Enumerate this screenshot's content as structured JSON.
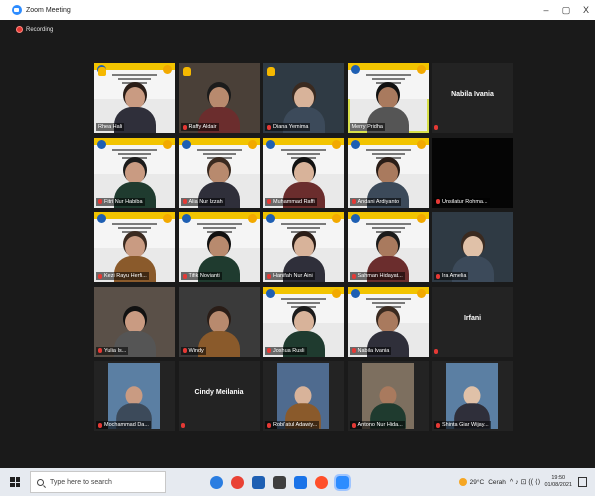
{
  "window": {
    "title": "Zoom Meeting",
    "controls": [
      "–",
      "▢",
      "X"
    ]
  },
  "recording": {
    "label": "Recording"
  },
  "participants": [
    {
      "name": "Rhea Hali",
      "muted": false,
      "hand": true,
      "slide": true,
      "video": true
    },
    {
      "name": "Raffy Aldair",
      "muted": true,
      "hand": true,
      "slide": false,
      "video": true
    },
    {
      "name": "Diana Yemima",
      "muted": true,
      "hand": true,
      "slide": false,
      "video": true
    },
    {
      "name": "Merry Pridha",
      "muted": false,
      "hand": false,
      "slide": true,
      "video": true,
      "active": true
    },
    {
      "name": "Nabila Ivania",
      "muted": true,
      "video": false
    },
    {
      "name": "Fitri Nur Habiba",
      "muted": true,
      "slide": true,
      "video": true
    },
    {
      "name": "Alia Nur Izzah",
      "muted": true,
      "slide": true,
      "video": true
    },
    {
      "name": "Muhammad Raffi",
      "muted": true,
      "slide": true,
      "video": true
    },
    {
      "name": "Andani Ardiyanto",
      "muted": true,
      "slide": true,
      "video": true
    },
    {
      "name": "Unsilatur Rohma...",
      "muted": true,
      "slide": false,
      "video": true,
      "dark": true
    },
    {
      "name": "Kezi Rayu Herfi...",
      "muted": true,
      "slide": true,
      "video": true
    },
    {
      "name": "Tifik Novianti",
      "muted": true,
      "slide": true,
      "video": true
    },
    {
      "name": "Hanifah Nur Aini",
      "muted": true,
      "slide": true,
      "video": true
    },
    {
      "name": "Sahman Hidayat...",
      "muted": true,
      "slide": true,
      "video": true
    },
    {
      "name": "Ira Amelia",
      "muted": true,
      "slide": false,
      "video": true
    },
    {
      "name": "Yulia Is...",
      "muted": true,
      "slide": false,
      "video": true
    },
    {
      "name": "Windy",
      "muted": true,
      "slide": false,
      "video": true
    },
    {
      "name": "Joshua Rusli",
      "muted": true,
      "slide": true,
      "video": true
    },
    {
      "name": "Nabila Ivania",
      "muted": true,
      "slide": true,
      "video": true
    },
    {
      "name": "Irfani",
      "muted": true,
      "video": false
    },
    {
      "name": "Mochammad Da...",
      "muted": true,
      "slide": false,
      "video": true,
      "photo": true
    },
    {
      "name": "Cindy Meilania",
      "muted": true,
      "video": false
    },
    {
      "name": "Robi'atul Adawiy...",
      "muted": true,
      "slide": false,
      "video": true,
      "photo": true
    },
    {
      "name": "Antono Nur Hida...",
      "muted": true,
      "slide": false,
      "video": true,
      "photo": true
    },
    {
      "name": "Shinta Giar Wijay...",
      "muted": true,
      "slide": false,
      "video": true,
      "photo": true
    }
  ],
  "taskbar": {
    "search_placeholder": "Type here to search",
    "weather_temp": "29°C",
    "weather_label": "Cerah",
    "tray_icons": "^ ♪ ⊡ ((  ⟨⟩",
    "time": "19:50",
    "date": "01/08/2021"
  },
  "colors": {
    "slide_accent": "#f2c400",
    "active_border": "#d8e04a",
    "muted_icon": "#e53935",
    "tile_bg": "#232323",
    "window_bg": "#1a1a1a"
  }
}
